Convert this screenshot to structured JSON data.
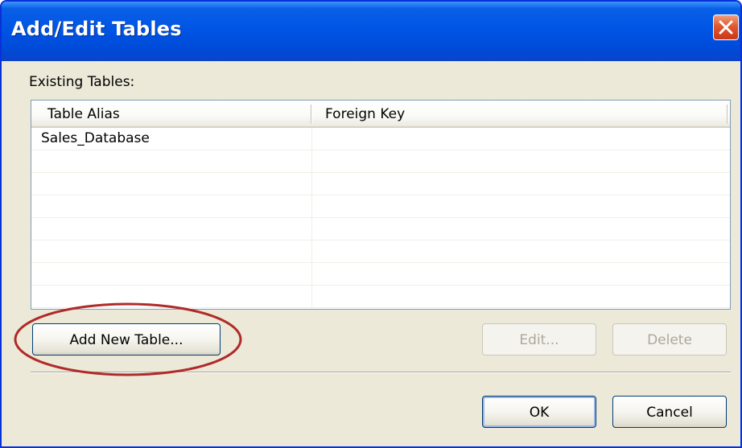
{
  "window": {
    "title": "Add/Edit Tables",
    "close_icon": "close-x-icon"
  },
  "existing_tables": {
    "label": "Existing Tables:",
    "columns": [
      "Table Alias",
      "Foreign Key"
    ],
    "rows": [
      [
        "Sales_Database",
        ""
      ],
      [
        "",
        ""
      ],
      [
        "",
        ""
      ],
      [
        "",
        ""
      ],
      [
        "",
        ""
      ],
      [
        "",
        ""
      ],
      [
        "",
        ""
      ],
      [
        "",
        ""
      ]
    ]
  },
  "buttons": {
    "add_new_table": "Add New Table...",
    "edit": "Edit...",
    "delete": "Delete",
    "ok": "OK",
    "cancel": "Cancel"
  },
  "colors": {
    "titlebar": "#0055e5",
    "dialog_bg": "#ece9d8",
    "annotation": "#b02a2a"
  }
}
